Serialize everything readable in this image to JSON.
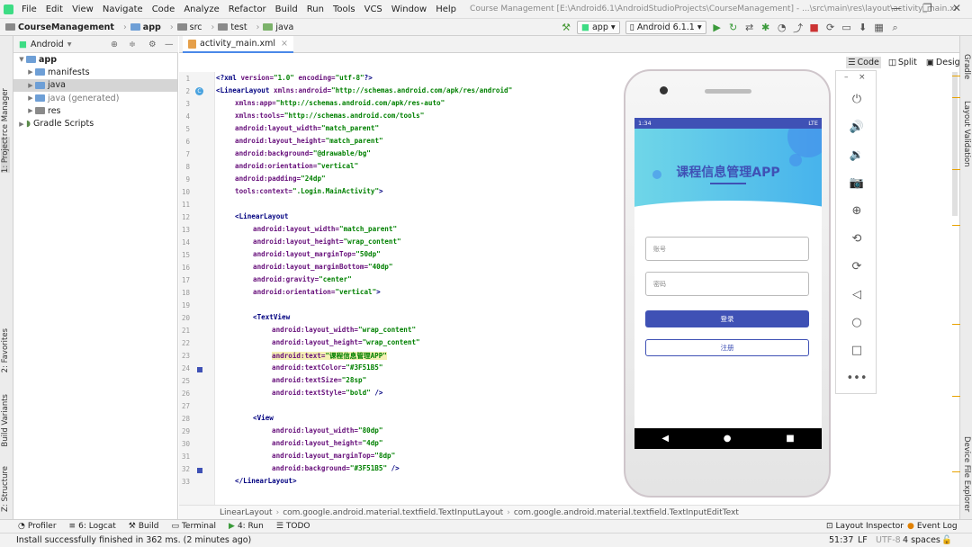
{
  "menu": {
    "items": [
      "File",
      "Edit",
      "View",
      "Navigate",
      "Code",
      "Analyze",
      "Refactor",
      "Build",
      "Run",
      "Tools",
      "VCS",
      "Window",
      "Help"
    ],
    "window_title": "Course Management [E:\\Android6.1\\AndroidStudioProjects\\CourseManagement] - ...\\src\\main\\res\\layout\\activity_main.xml [app]"
  },
  "breadcrumb": [
    "CourseManagement",
    "app",
    "src",
    "test",
    "java"
  ],
  "toolbar": {
    "run_config": "app",
    "device": "Android 6.1.1"
  },
  "project": {
    "view": "Android",
    "tree": [
      {
        "label": "app",
        "level": 0,
        "bold": true
      },
      {
        "label": "manifests",
        "level": 1
      },
      {
        "label": "java",
        "level": 1
      },
      {
        "label": "java (generated)",
        "level": 1
      },
      {
        "label": "res",
        "level": 1
      },
      {
        "label": "Gradle Scripts",
        "level": 0
      }
    ]
  },
  "editor": {
    "tab": "activity_main.xml",
    "modes": [
      "Code",
      "Split",
      "Design"
    ],
    "active_mode": "Code",
    "line_numbers": [
      "1",
      "2",
      "3",
      "4",
      "5",
      "6",
      "7",
      "8",
      "9",
      "10",
      "11",
      "12",
      "13",
      "14",
      "15",
      "16",
      "17",
      "18",
      "19",
      "20",
      "21",
      "22",
      "23",
      "24",
      "25",
      "26",
      "27",
      "28",
      "29",
      "30",
      "31",
      "32",
      "33"
    ]
  },
  "side_left": [
    "Resource Manager",
    "1: Project",
    "2: Favorites",
    "Build Variants",
    "Z: Structure"
  ],
  "side_right": [
    "Gradle",
    "Layout Validation",
    "Device File Explorer"
  ],
  "phone": {
    "time": "1:34",
    "status_right": "LTE",
    "title": "课程信息管理APP",
    "account_hint": "账号",
    "password_hint": "密码",
    "login": "登录",
    "register": "注册"
  },
  "path_bar": [
    "LinearLayout",
    "com.google.android.material.textfield.TextInputLayout",
    "com.google.android.material.textfield.TextInputEditText"
  ],
  "tool_windows": [
    "Profiler",
    "6: Logcat",
    "Build",
    "Terminal",
    "4: Run",
    "TODO"
  ],
  "tool_windows_right": [
    "Layout Inspector",
    "Event Log"
  ],
  "status": {
    "message": "Install successfully finished in 362 ms. (2 minutes ago)",
    "position": "51:37",
    "line_sep": "LF",
    "encoding": "UTF-8",
    "indent": "4 spaces"
  }
}
